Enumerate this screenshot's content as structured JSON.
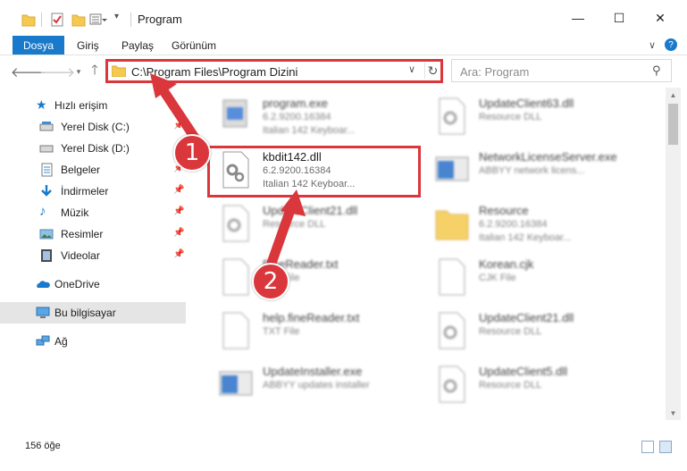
{
  "window": {
    "title": "Program",
    "controls": {
      "minimize": "—",
      "maximize": "☐",
      "close": "✕"
    }
  },
  "ribbon": {
    "tabs": [
      "Dosya",
      "Giriş",
      "Paylaş",
      "Görünüm"
    ],
    "expand_icon": "∨",
    "help_icon": "?"
  },
  "address": {
    "path": "C:\\Program Files\\Program Dizini",
    "search_placeholder": "Ara: Program"
  },
  "nav": {
    "quick_access": "Hızlı erişim",
    "items": [
      {
        "label": "Yerel Disk (C:)",
        "icon": "drive-icon",
        "pinned": true
      },
      {
        "label": "Yerel Disk (D:)",
        "icon": "drive-icon",
        "pinned": true
      },
      {
        "label": "Belgeler",
        "icon": "documents-icon",
        "pinned": true
      },
      {
        "label": "İndirmeler",
        "icon": "download-icon",
        "pinned": true
      },
      {
        "label": "Müzik",
        "icon": "music-icon",
        "pinned": true
      },
      {
        "label": "Resimler",
        "icon": "pictures-icon",
        "pinned": true
      },
      {
        "label": "Videolar",
        "icon": "videos-icon",
        "pinned": true
      }
    ],
    "onedrive": "OneDrive",
    "this_pc": "Bu bilgisayar",
    "network": "Ağ"
  },
  "files": [
    {
      "name": "program.exe",
      "meta1": "6.2.9200.16384",
      "meta2": "Italian 142 Keyboar...",
      "icon": "exe-icon"
    },
    {
      "name": "UpdateClient63.dll",
      "meta1": "Resource DLL",
      "meta2": "",
      "icon": "dll-icon"
    },
    {
      "name": "kbdit142.dll",
      "meta1": "6.2.9200.16384",
      "meta2": "Italian 142 Keyboar...",
      "icon": "dll-gear-icon"
    },
    {
      "name": "NetworkLicenseServer.exe",
      "meta1": "ABBYY network licens...",
      "meta2": "",
      "icon": "exe-window-icon"
    },
    {
      "name": "UpdateClient21.dll",
      "meta1": "Resource DLL",
      "meta2": "",
      "icon": "dll-icon"
    },
    {
      "name": "Resource",
      "meta1": "6.2.9200.16384",
      "meta2": "Italian 142 Keyboar...",
      "icon": "folder-icon"
    },
    {
      "name": "FineReader.txt",
      "meta1": "TXT File",
      "meta2": "",
      "icon": "txt-icon"
    },
    {
      "name": "Korean.cjk",
      "meta1": "CJK File",
      "meta2": "",
      "icon": "file-icon"
    },
    {
      "name": "help.fineReader.txt",
      "meta1": "TXT File",
      "meta2": "",
      "icon": "txt-icon"
    },
    {
      "name": "UpdateClient21.dll",
      "meta1": "Resource DLL",
      "meta2": "",
      "icon": "dll-icon"
    },
    {
      "name": "UpdateInstaller.exe",
      "meta1": "ABBYY updates installer",
      "meta2": "",
      "icon": "exe-window-icon"
    },
    {
      "name": "UpdateClient5.dll",
      "meta1": "Resource DLL",
      "meta2": "",
      "icon": "dll-icon"
    }
  ],
  "status": {
    "count": "156 öğe"
  },
  "callouts": [
    "1",
    "2"
  ],
  "colors": {
    "accent": "#1979ca",
    "highlight": "#d9373c"
  }
}
